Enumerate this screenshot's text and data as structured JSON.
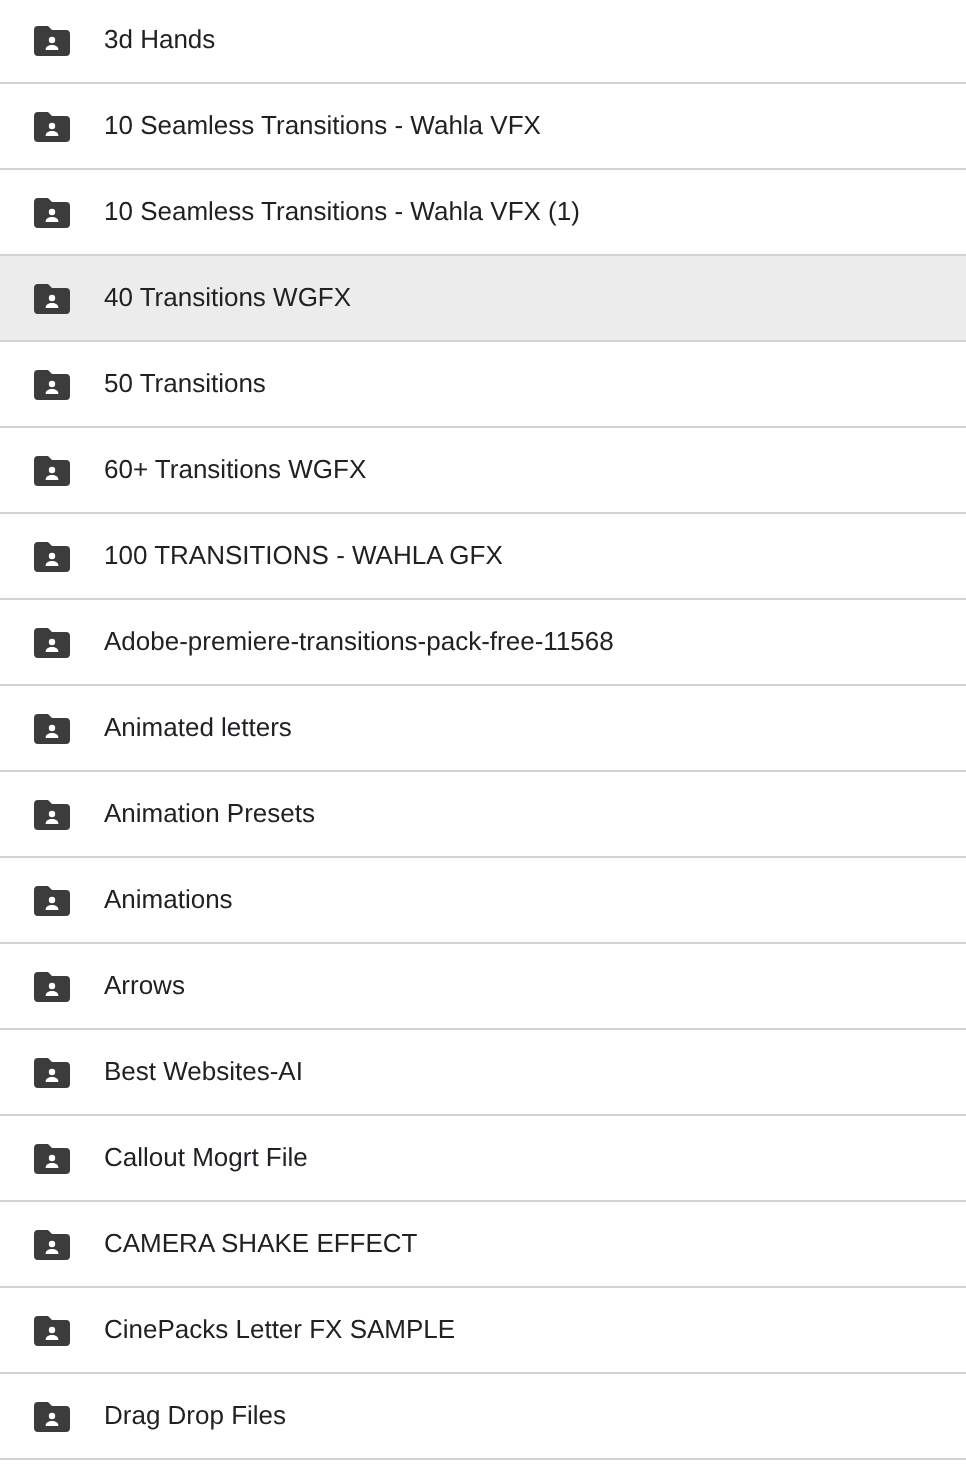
{
  "folders": [
    {
      "name": "3d Hands",
      "selected": false
    },
    {
      "name": "10 Seamless Transitions - Wahla VFX",
      "selected": false
    },
    {
      "name": "10 Seamless Transitions - Wahla VFX (1)",
      "selected": false
    },
    {
      "name": "40 Transitions WGFX",
      "selected": true
    },
    {
      "name": "50 Transitions",
      "selected": false
    },
    {
      "name": "60+ Transitions WGFX",
      "selected": false
    },
    {
      "name": "100 TRANSITIONS - WAHLA GFX",
      "selected": false
    },
    {
      "name": "Adobe-premiere-transitions-pack-free-11568",
      "selected": false
    },
    {
      "name": "Animated letters",
      "selected": false
    },
    {
      "name": "Animation Presets",
      "selected": false
    },
    {
      "name": "Animations",
      "selected": false
    },
    {
      "name": "Arrows",
      "selected": false
    },
    {
      "name": "Best Websites-AI",
      "selected": false
    },
    {
      "name": "Callout Mogrt File",
      "selected": false
    },
    {
      "name": "CAMERA SHAKE EFFECT",
      "selected": false
    },
    {
      "name": "CinePacks Letter FX SAMPLE",
      "selected": false
    },
    {
      "name": "Drag Drop Files",
      "selected": false
    }
  ]
}
